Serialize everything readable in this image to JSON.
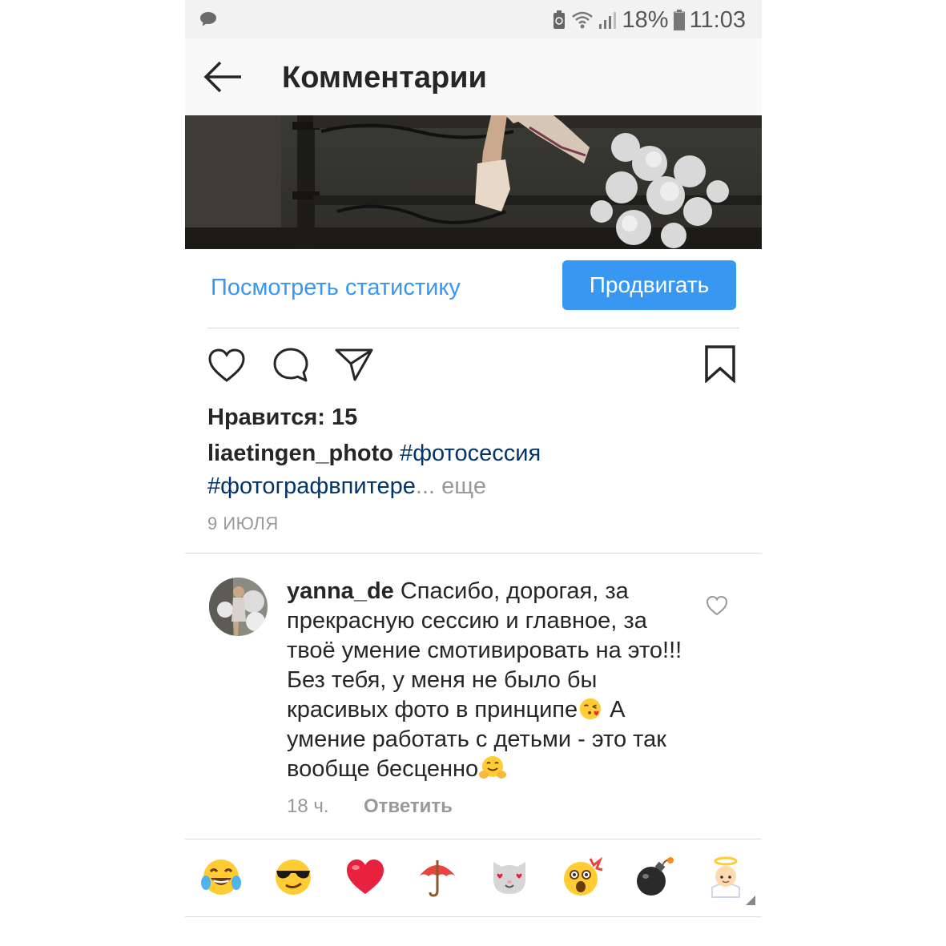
{
  "status_bar": {
    "battery_percent": "18%",
    "time": "11:03"
  },
  "header": {
    "title": "Комментарии"
  },
  "post": {
    "stats_link": "Посмотреть статистику",
    "promote_button": "Продвигать",
    "likes": "Нравится: 15",
    "caption_user": "liaetingen_photo",
    "caption_tag1": "#фотосессия",
    "caption_tag2": "#фотографвпитере",
    "caption_ellipsis": "...",
    "caption_more": "еще",
    "date": "9 ИЮЛЯ"
  },
  "comment": {
    "username": "yanna_de",
    "text_part1": "Спасибо, дорогая, за прекрасную сессию и главное, за твоё умение смотивировать на это!!! Без тебя, у меня не было бы красивых фото в принципе",
    "text_part2": " А умение работать с детьми - это так вообще бесценно",
    "time": "18 ч.",
    "reply": "Ответить"
  },
  "emoji_bar": [
    "tears-of-joy-emoji",
    "sunglasses-emoji",
    "red-heart-emoji",
    "umbrella-emoji",
    "heart-eyes-cat-emoji",
    "exploding-head-emoji",
    "bomb-emoji",
    "angel-emoji"
  ],
  "colors": {
    "accent": "#3897f0",
    "hashtag": "#003569",
    "text": "#262626",
    "muted": "#999999"
  }
}
